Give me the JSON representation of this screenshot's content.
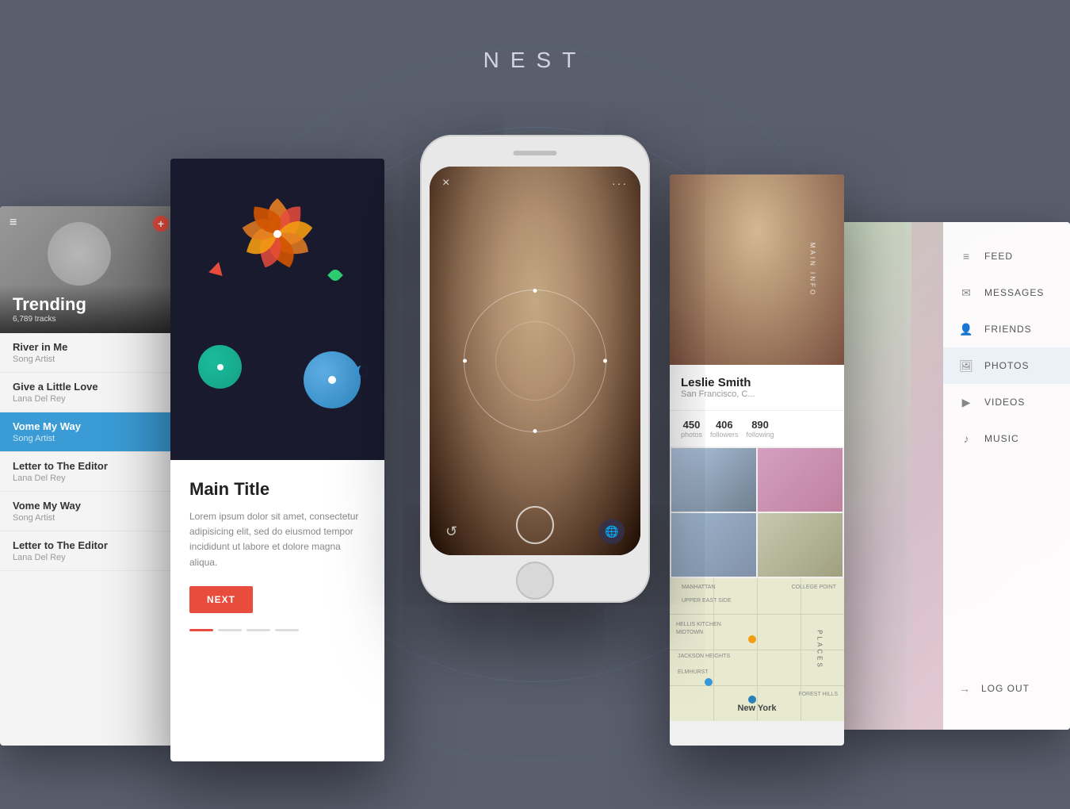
{
  "app": {
    "title": "NEST"
  },
  "music_screen": {
    "trending_label": "Trending",
    "trending_sub": "6,789 tracks",
    "items": [
      {
        "title": "River in Me",
        "artist": "Song Artist",
        "active": false
      },
      {
        "title": "Give a Little Love",
        "artist": "Lana Del Rey",
        "active": false
      },
      {
        "title": "Vome My Way",
        "artist": "Song Artist",
        "active": true
      },
      {
        "title": "Letter to The Editor",
        "artist": "Lana Del Rey",
        "active": false
      },
      {
        "title": "Vome My Way",
        "artist": "Song Artist",
        "active": false
      },
      {
        "title": "Letter to The Editor",
        "artist": "Lana Del Rey",
        "active": false
      }
    ]
  },
  "presentation_screen": {
    "main_title": "Main Title",
    "body_text": "Lorem ipsum dolor sit amet, consectetur adipisicing elit, sed do eiusmod tempor incididunt ut labore et dolore magna aliqua.",
    "next_button": "NEXT"
  },
  "center_phone": {
    "close_icon": "×",
    "dots_icon": "···",
    "refresh_icon": "↺"
  },
  "profile_screen": {
    "name": "Leslie Smith",
    "location": "San Francisco, C...",
    "stats": [
      {
        "num": "450",
        "label": "photos"
      },
      {
        "num": "406",
        "label": "followers"
      },
      {
        "num": "890",
        "label": "following"
      }
    ],
    "side_label_top": "MAIN INFO",
    "side_label_bottom": "PLACES",
    "map_city": "New York",
    "map_labels": [
      "MANHATTAN",
      "UPPER EAST SIDE",
      "HELLIS KITCHEN MIDTOWN",
      "JACKSON HEIGHTS",
      "ELMHURST",
      "COLLEGE POINT",
      "FOREST HILLS"
    ]
  },
  "social_screen": {
    "menu_items": [
      {
        "icon": "≡",
        "label": "FEED"
      },
      {
        "icon": "✉",
        "label": "MESSAGES"
      },
      {
        "icon": "♟",
        "label": "FRIENDS"
      },
      {
        "icon": "🖼",
        "label": "PHOTOS"
      },
      {
        "icon": "▶",
        "label": "VIDEOS"
      },
      {
        "icon": "♪",
        "label": "MUSIC"
      }
    ],
    "logout_label": "LOG OUT"
  }
}
